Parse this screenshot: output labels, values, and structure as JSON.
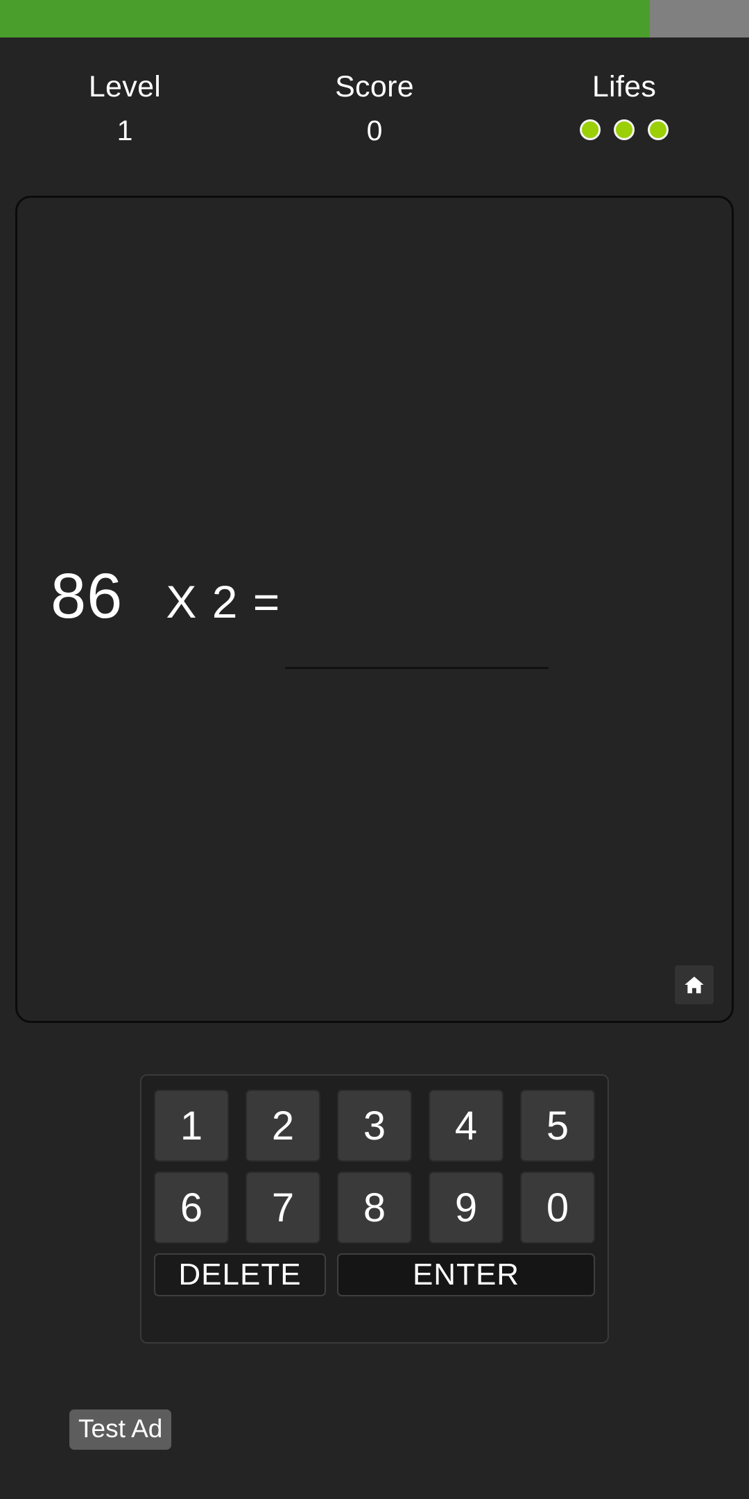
{
  "top_strip": {
    "green_color": "#4a9e2c",
    "grey_color": "#808080"
  },
  "hud": {
    "level": {
      "label": "Level",
      "value": "1"
    },
    "score": {
      "label": "Score",
      "value": "0"
    },
    "lives": {
      "label": "Lifes",
      "count": 3,
      "dot_color": "#9bcf08",
      "dots": [
        "life-1",
        "life-2",
        "life-3"
      ]
    }
  },
  "game": {
    "equation": {
      "operand_a": "86",
      "operator_and_rest": "X 2 =",
      "operator": "X",
      "operand_b": "2",
      "equals": "=",
      "answer": ""
    },
    "home_button": {
      "icon": "home-icon"
    }
  },
  "keypad": {
    "rows": [
      [
        "1",
        "2",
        "3",
        "4",
        "5"
      ],
      [
        "6",
        "7",
        "8",
        "9",
        "0"
      ]
    ],
    "delete_label": "DELETE",
    "enter_label": "ENTER"
  },
  "ad": {
    "label": "Test Ad"
  }
}
